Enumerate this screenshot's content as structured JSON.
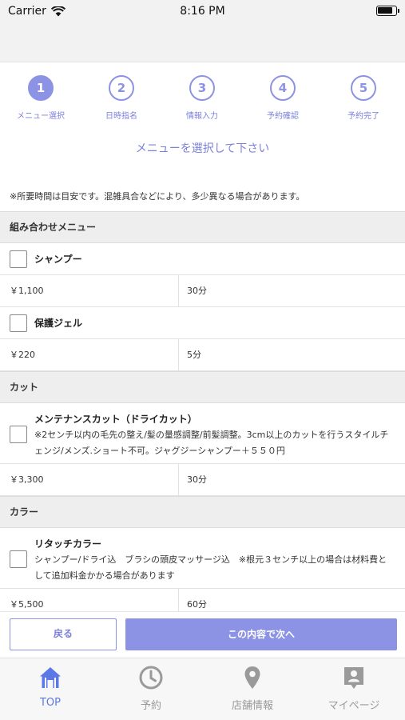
{
  "status_bar": {
    "carrier": "Carrier",
    "time": "8:16 PM"
  },
  "steps": [
    {
      "number": "1",
      "label": "メニュー選択",
      "active": true
    },
    {
      "number": "2",
      "label": "日時指名",
      "active": false
    },
    {
      "number": "3",
      "label": "情報入力",
      "active": false
    },
    {
      "number": "4",
      "label": "予約確認",
      "active": false
    },
    {
      "number": "5",
      "label": "予約完了",
      "active": false
    }
  ],
  "page_heading": "メニューを選択して下さい",
  "notice": "※所要時間は目安です。混雑具合などにより、多少異なる場合があります。",
  "sections": [
    {
      "title": "組み合わせメニュー",
      "items": [
        {
          "name": "シャンプー",
          "description": "",
          "price": "￥1,100",
          "duration": "30分",
          "checked": false
        },
        {
          "name": "保護ジェル",
          "description": "",
          "price": "￥220",
          "duration": "5分",
          "checked": false
        }
      ]
    },
    {
      "title": "カット",
      "items": [
        {
          "name": "メンテナンスカット（ドライカット）",
          "description": "※2センチ以内の毛先の整え/髪の量感調整/前髪調整。3cm以上のカットを行うスタイルチェンジ/メンズ.ショート不可。ジャグジーシャンプー＋５５０円",
          "price": "￥3,300",
          "duration": "30分",
          "checked": false
        }
      ]
    },
    {
      "title": "カラー",
      "items": [
        {
          "name": "リタッチカラー",
          "description": "シャンプー/ドライ込　ブラシの頭皮マッサージ込　※根元３センチ以上の場合は材料費として追加料金かかる場合があります",
          "price": "￥5,500",
          "duration": "60分",
          "checked": false
        }
      ]
    }
  ],
  "actions": {
    "back_label": "戻る",
    "next_label": "この内容で次へ"
  },
  "tab_bar": {
    "items": [
      {
        "label": "TOP",
        "icon": "home-icon",
        "active": true
      },
      {
        "label": "予約",
        "icon": "clock-icon",
        "active": false
      },
      {
        "label": "店舗情報",
        "icon": "map-pin-icon",
        "active": false
      },
      {
        "label": "マイページ",
        "icon": "person-card-icon",
        "active": false
      }
    ]
  },
  "colors": {
    "accent": "#8d93e4",
    "accent_text": "#7b80db",
    "tab_active": "#5b78e6",
    "tab_inactive": "#9a9a9a"
  }
}
